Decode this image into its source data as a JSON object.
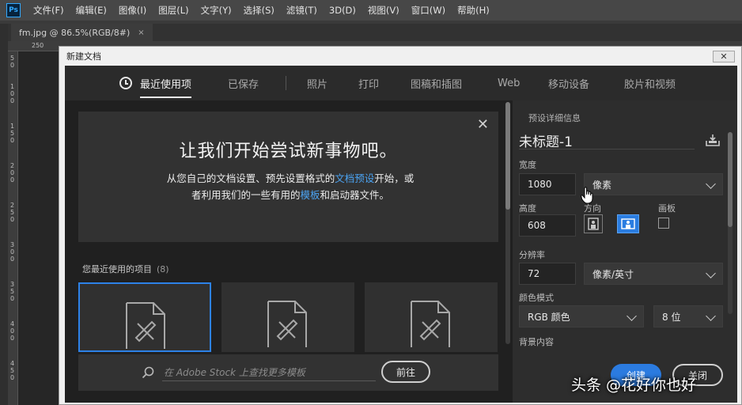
{
  "app": {
    "logo": "Ps"
  },
  "menu": [
    "文件(F)",
    "编辑(E)",
    "图像(I)",
    "图层(L)",
    "文字(Y)",
    "选择(S)",
    "滤镜(T)",
    "3D(D)",
    "视图(V)",
    "窗口(W)",
    "帮助(H)"
  ],
  "document_tab": {
    "title": "fm.jpg @ 86.5%(RGB/8#)",
    "close": "×"
  },
  "ruler": {
    "top_number": "250",
    "left_numbers": [
      "5\n0",
      "1\n0\n0",
      "1\n5\n0",
      "2\n0\n0",
      "2\n5\n0",
      "3\n0\n0",
      "3\n5\n0",
      "4\n0\n0",
      "4\n5\n0"
    ]
  },
  "dialog": {
    "title": "新建文档",
    "close": "✕",
    "tabs": [
      {
        "label": "最近使用项",
        "active": true
      },
      {
        "label": "已保存",
        "active": false
      },
      {
        "label": "照片",
        "active": false
      },
      {
        "label": "打印",
        "active": false
      },
      {
        "label": "图稿和插图",
        "active": false
      },
      {
        "label": "Web",
        "active": false
      },
      {
        "label": "移动设备",
        "active": false
      },
      {
        "label": "胶片和视频",
        "active": false
      }
    ],
    "welcome": {
      "close": "✕",
      "title": "让我们开始尝试新事物吧。",
      "text_1": "从您自己的文档设置、预先设置格式的",
      "link_1": "文档预设",
      "text_2": "开始，或者利用我们的一些有用的",
      "link_2": "模板",
      "text_3": "和启动器文件。"
    },
    "recent": {
      "label": "您最近使用的项目",
      "count": "(8)"
    },
    "stock": {
      "placeholder": "在 Adobe Stock 上查找更多模板",
      "go_button": "前往"
    },
    "details": {
      "heading": "预设详细信息",
      "name": "未标题-1",
      "width_label": "宽度",
      "width_value": "1080",
      "width_unit": "像素",
      "height_label": "高度",
      "height_value": "608",
      "orientation_label": "方向",
      "artboard_label": "画板",
      "resolution_label": "分辨率",
      "resolution_value": "72",
      "resolution_unit": "像素/英寸",
      "color_mode_label": "颜色模式",
      "color_mode_value": "RGB 颜色",
      "bit_depth_value": "8 位",
      "background_label": "背景内容",
      "create_button": "创建",
      "close_button": "关闭"
    }
  },
  "watermark": "头条 @花好你也好",
  "colors": {
    "accent_blue": "#2b7be0",
    "link_blue": "#4ba3f2",
    "panel_dark": "#202020",
    "menu_bar": "#474747"
  }
}
